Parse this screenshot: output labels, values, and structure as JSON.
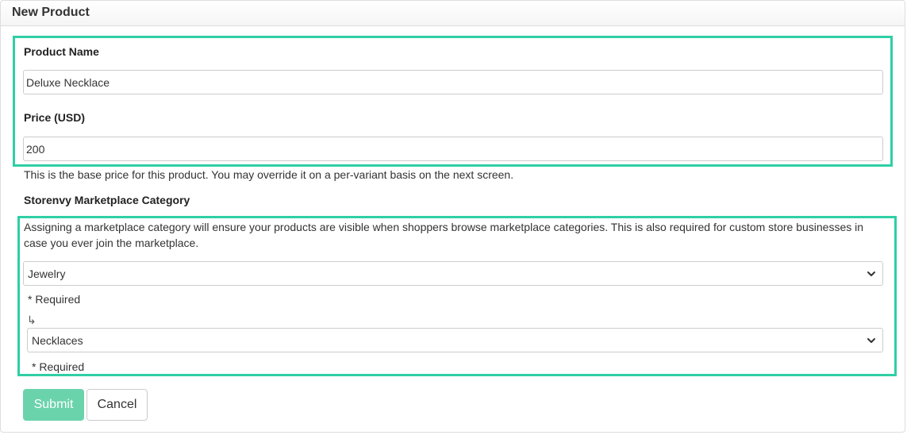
{
  "panel": {
    "title": "New Product"
  },
  "form": {
    "product_name": {
      "label": "Product Name",
      "value": "Deluxe Necklace"
    },
    "price": {
      "label": "Price (USD)",
      "value": "200",
      "help": "This is the base price for this product. You may override it on a per-variant basis on the next screen."
    },
    "category": {
      "label": "Storenvy Marketplace Category",
      "help": "Assigning a marketplace category will ensure your products are visible when shoppers browse marketplace categories. This is also required for custom store businesses in case you ever join the marketplace.",
      "primary_select": {
        "value": "Jewelry",
        "required_text": "* Required"
      },
      "subcategory_arrow": "↳",
      "secondary_select": {
        "value": "Necklaces",
        "required_text": "* Required"
      }
    }
  },
  "actions": {
    "submit_label": "Submit",
    "cancel_label": "Cancel"
  },
  "colors": {
    "highlight": "#2fcfa5",
    "submit_bg": "#6bd3ac"
  },
  "icons": {
    "select_arrow": "chevron-down-icon"
  }
}
